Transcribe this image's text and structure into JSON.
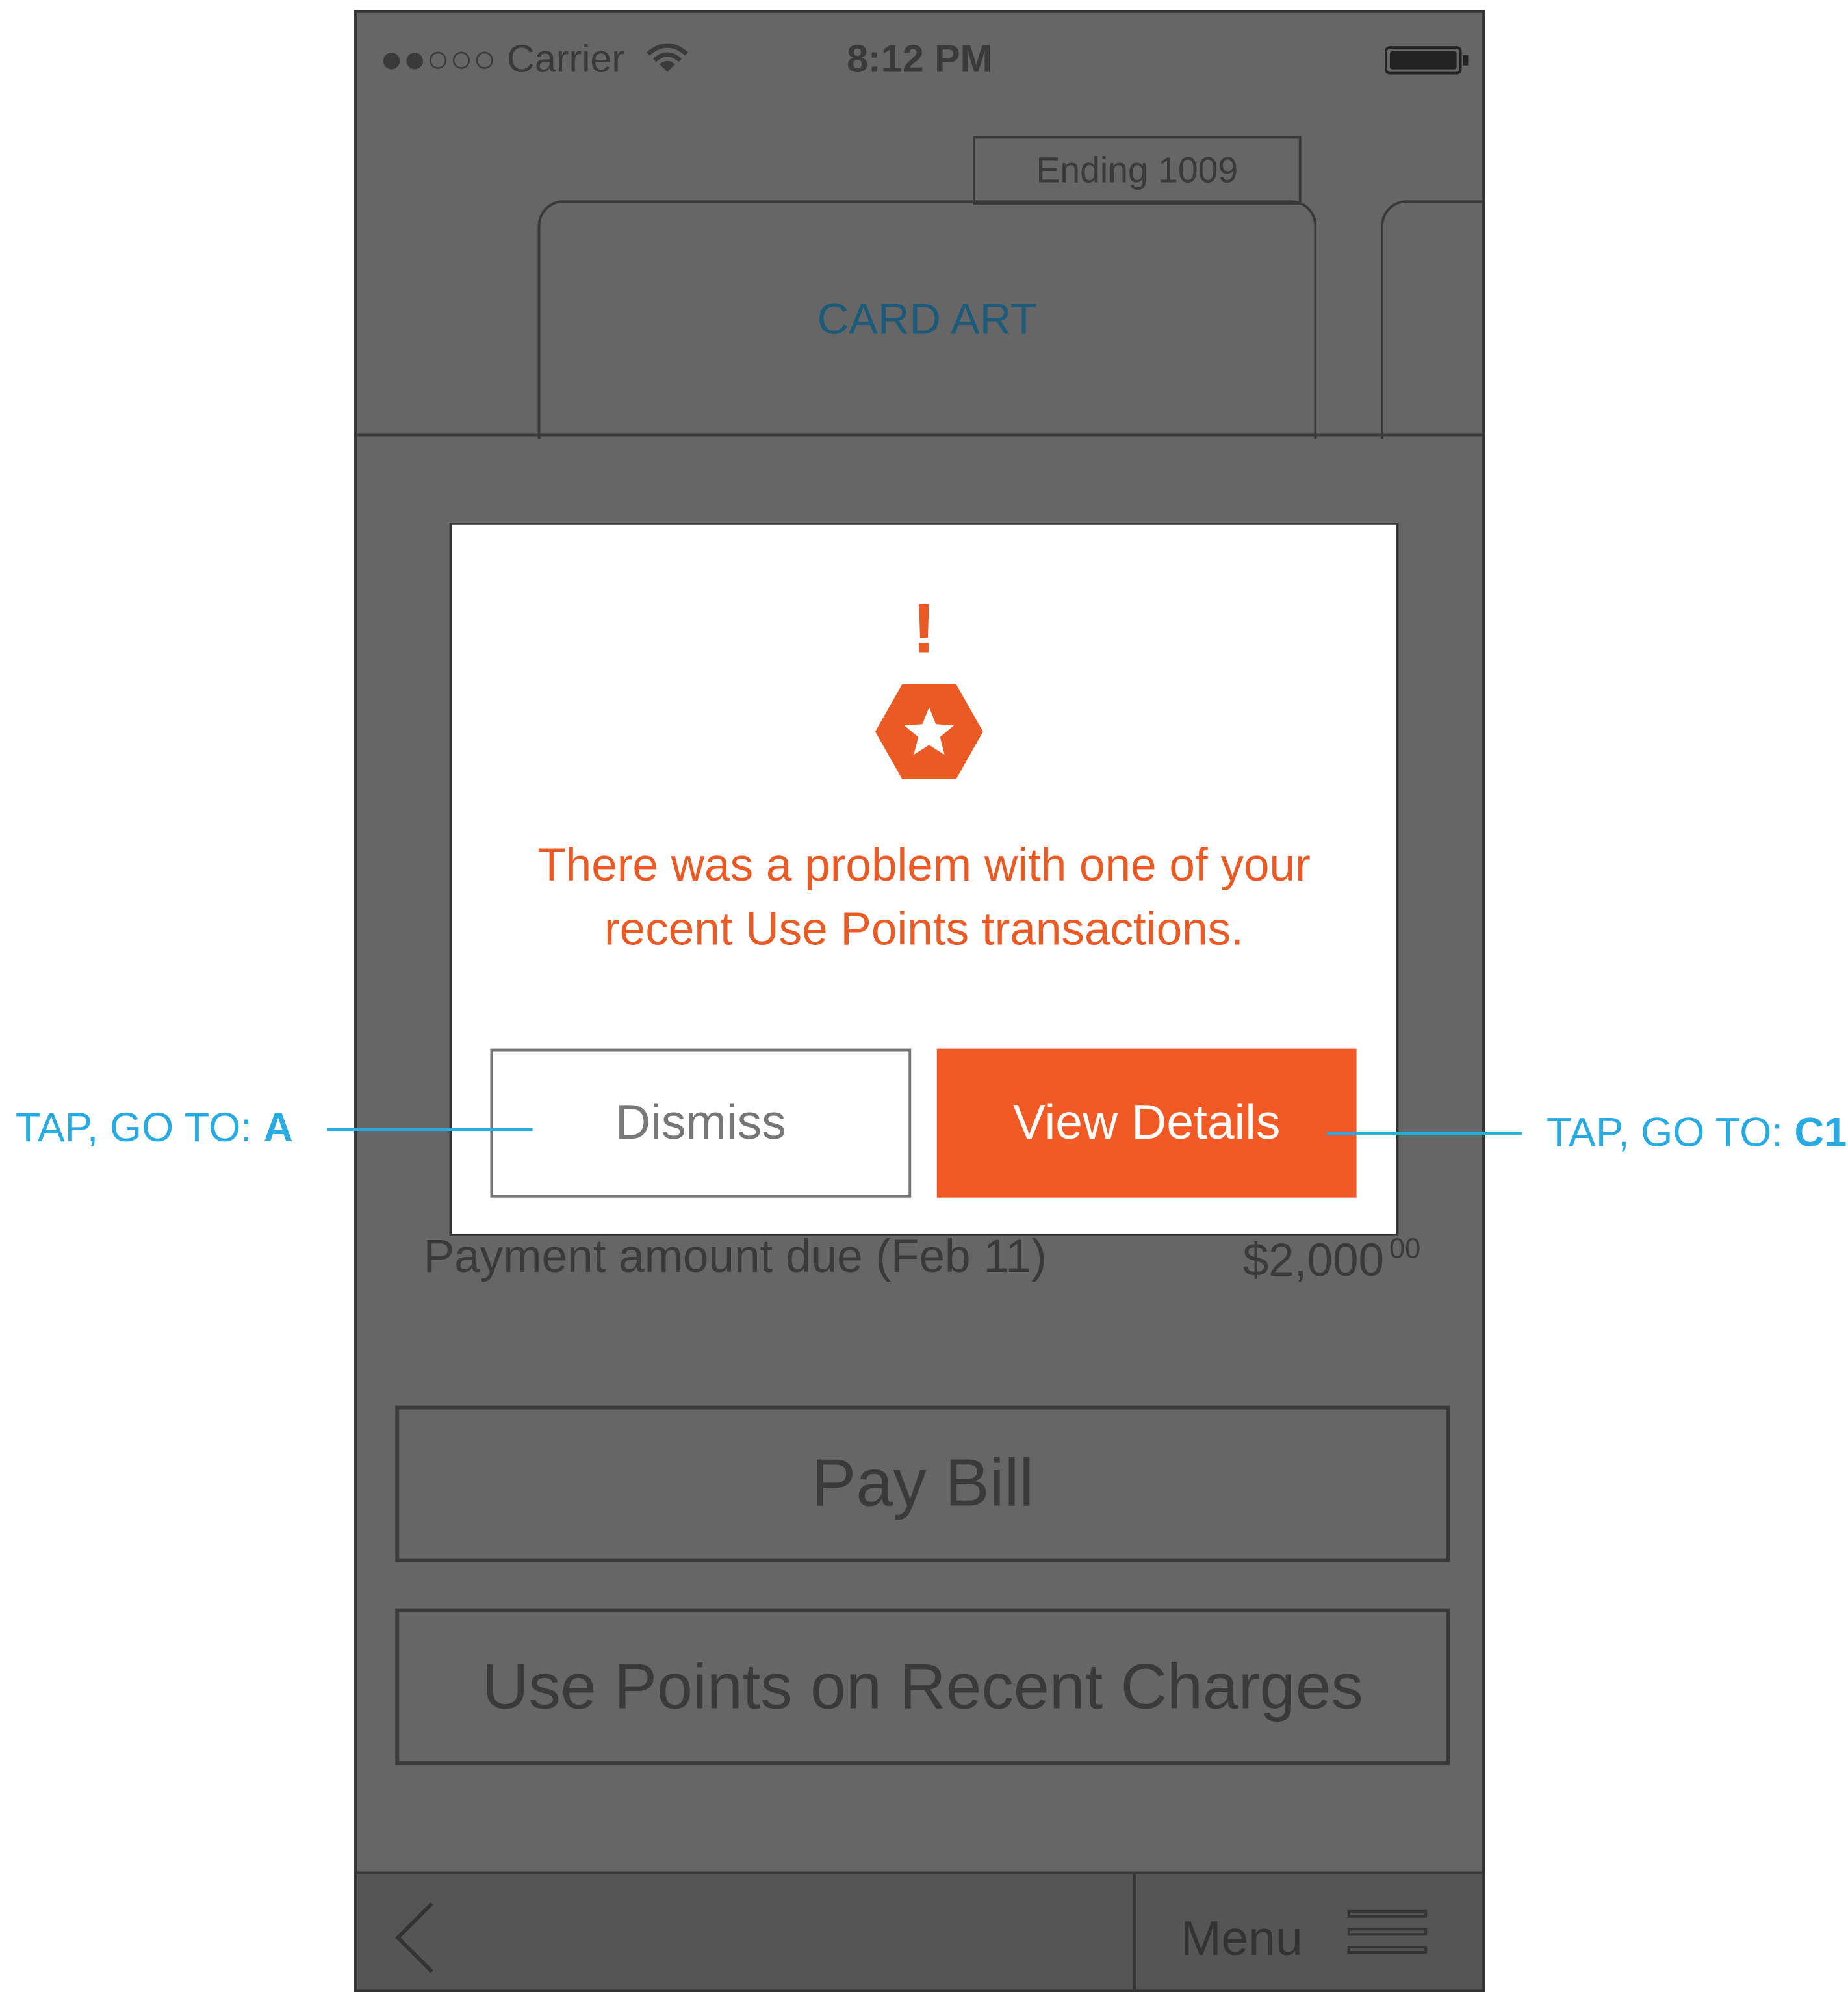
{
  "status_bar": {
    "signal": "●●○○○",
    "carrier": "Carrier",
    "time": "8:12 PM"
  },
  "card": {
    "ending": "Ending 1009",
    "art_label": "CARD ART"
  },
  "summary": {
    "payment_label": "Payment amount due (Feb 11)",
    "payment_amount": "$2,000",
    "payment_cents": "00"
  },
  "actions": {
    "pay_bill": "Pay Bill",
    "use_points": "Use Points on Recent Charges"
  },
  "bottom_bar": {
    "menu_label": "Menu"
  },
  "modal": {
    "exclamation": "!",
    "message": "There was a problem with one of your recent Use Points transactions.",
    "dismiss_label": "Dismiss",
    "view_details_label": "View Details"
  },
  "annotations": {
    "left_prefix": "TAP, GO TO: ",
    "left_target": "A",
    "right_prefix": "TAP, GO TO: ",
    "right_target": "C1"
  },
  "colors": {
    "accent": "#f15a24",
    "annotation": "#29abe2",
    "overlay": "#666666"
  },
  "icons": {
    "badge": "hexagon-star-icon",
    "back": "chevron-left-icon",
    "menu": "hamburger-icon",
    "wifi": "wifi-icon",
    "battery": "battery-icon"
  }
}
